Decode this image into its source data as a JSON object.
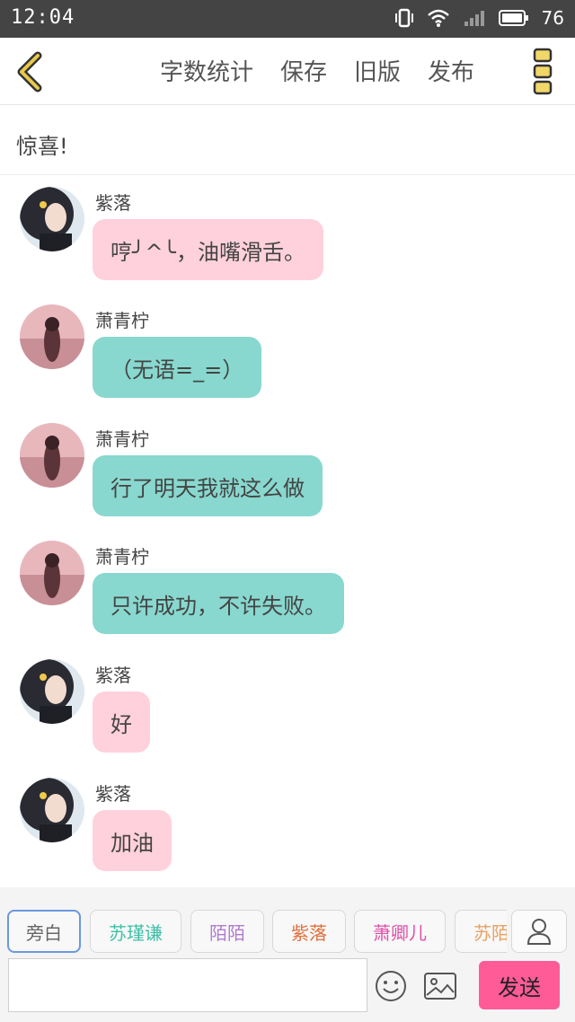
{
  "status_bar": {
    "time": "12:04",
    "battery_level": "76",
    "icons": [
      "vibrate-icon",
      "wifi-icon",
      "signal-icon",
      "battery-icon"
    ]
  },
  "top_bar": {
    "back_icon": "chevron-left-icon",
    "menu": [
      "字数统计",
      "保存",
      "旧版",
      "发布"
    ],
    "more_icon": "more-vertical-icon",
    "accent_color": "#e8c94c"
  },
  "title": "惊喜!",
  "messages": [
    {
      "sender": "紫落",
      "text": "哼╯^╰，油嘴滑舌。",
      "color": "pink",
      "avatar": "avatar-zi-luo"
    },
    {
      "sender": "萧青柠",
      "text": "（无语=_=）",
      "color": "teal",
      "avatar": "avatar-xiao-qing-ning"
    },
    {
      "sender": "萧青柠",
      "text": "行了明天我就这么做",
      "color": "teal",
      "avatar": "avatar-xiao-qing-ning"
    },
    {
      "sender": "萧青柠",
      "text": "只许成功，不许失败。",
      "color": "teal",
      "avatar": "avatar-xiao-qing-ning"
    },
    {
      "sender": "紫落",
      "text": "好",
      "color": "pink",
      "avatar": "avatar-zi-luo"
    },
    {
      "sender": "紫落",
      "text": "加油",
      "color": "pink",
      "avatar": "avatar-zi-luo"
    }
  ],
  "roles": [
    {
      "label": "旁白",
      "color": "#666666",
      "active": true
    },
    {
      "label": "苏瑾谦",
      "color": "#3fbfa8",
      "active": false
    },
    {
      "label": "陌陌",
      "color": "#b07ad0",
      "active": false
    },
    {
      "label": "紫落",
      "color": "#e0703e",
      "active": false
    },
    {
      "label": "萧卿儿",
      "color": "#e04fa8",
      "active": false
    },
    {
      "label": "苏陌",
      "color": "#e8a060",
      "active": false
    }
  ],
  "input": {
    "value": "",
    "placeholder": ""
  },
  "send_label": "发送",
  "colors": {
    "pink_bubble": "#ffd1dc",
    "teal_bubble": "#88d8cf",
    "send_button": "#ff5b97",
    "status_bar": "#444444"
  }
}
